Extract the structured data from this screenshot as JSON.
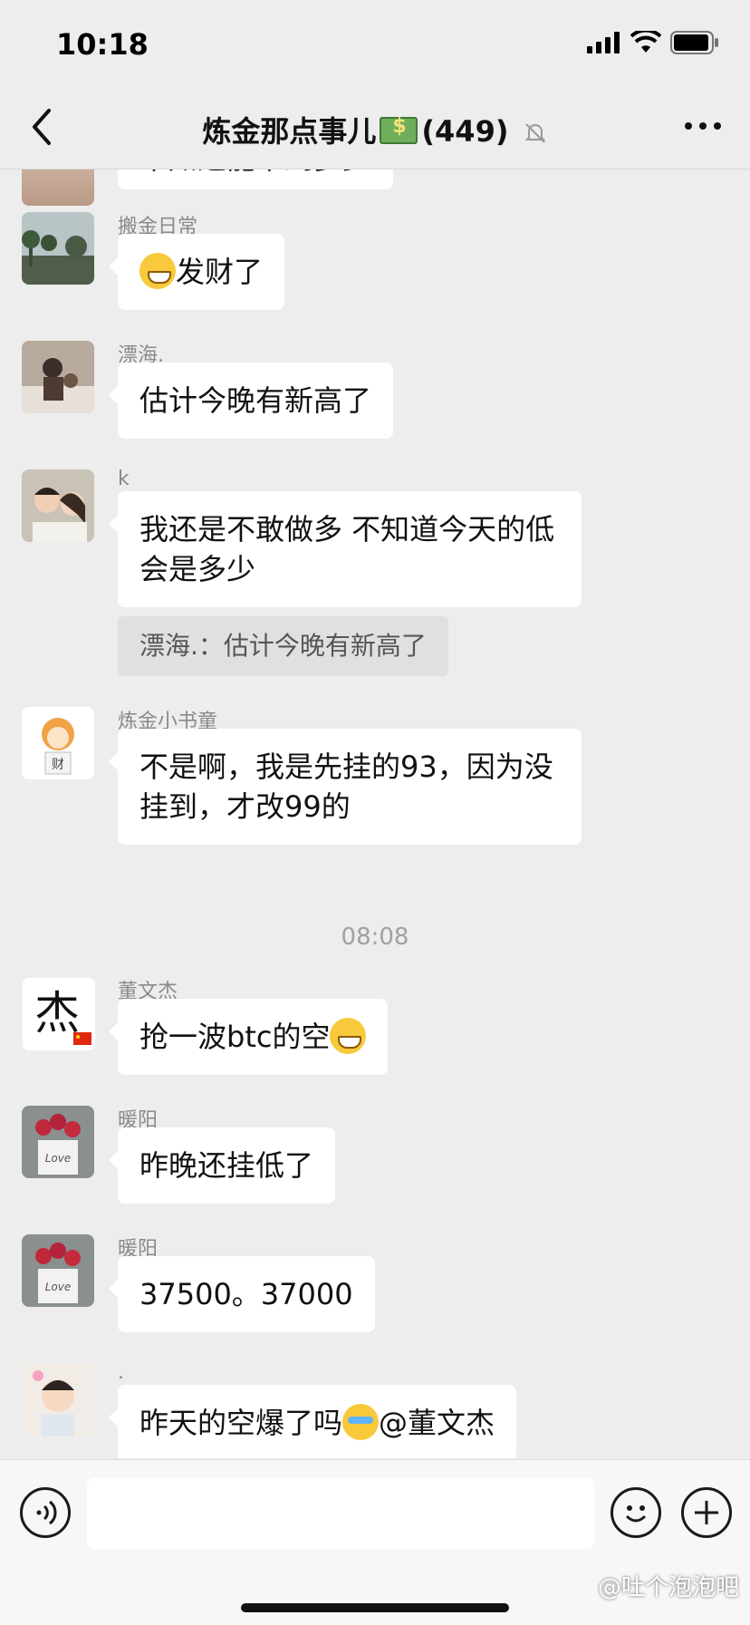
{
  "status": {
    "time": "10:18"
  },
  "header": {
    "title": "炼金那点事儿",
    "member_count": "(449)"
  },
  "partial_top_message": "不知道能下到多少",
  "messages": [
    {
      "sender": "搬金日常",
      "text": "发财了"
    },
    {
      "sender": "漂海.",
      "text": "估计今晚有新高了"
    },
    {
      "sender": "k",
      "text": "我还是不敢做多 不知道今天的低会是多少",
      "quote": "漂海.：估计今晚有新高了"
    },
    {
      "sender": "炼金小书童",
      "text": "不是啊，我是先挂的93，因为没挂到，才改99的"
    },
    {
      "sender": "董文杰",
      "text": "抢一波btc的空"
    },
    {
      "sender": "暖阳",
      "text": "昨晚还挂低了"
    },
    {
      "sender": "暖阳",
      "text": "37500。37000"
    },
    {
      "sender": ".",
      "text": "昨天的空爆了吗",
      "mention": "@董文杰"
    }
  ],
  "time_separator": "08:08",
  "avatar_text": {
    "dongwenjie": "杰",
    "shutong": "财",
    "love": "Love"
  },
  "input": {
    "placeholder": ""
  },
  "watermark": "@吐个泡泡吧",
  "colors": {
    "background": "#ededed",
    "bubble": "#ffffff",
    "quote": "#e0e0e0"
  }
}
